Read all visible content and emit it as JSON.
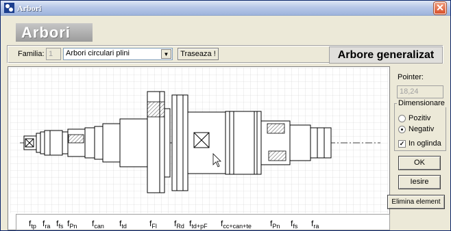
{
  "window": {
    "title": "Arbori",
    "close_glyph": "✕"
  },
  "logo": {
    "text": "Arbori"
  },
  "toolbar": {
    "familia_label": "Familia:",
    "familia_number": "1",
    "familia_value": "Arbori circulari plini",
    "traseaza_label": "Traseaza !",
    "heading": "Arbore generalizat"
  },
  "side_panel": {
    "pointer_label": "Pointer:",
    "pointer_value": "18,24",
    "dim_legend": "Dimensionare",
    "radio_pozitiv": "Pozitiv",
    "radio_negativ": "Negativ",
    "selected": "Negativ",
    "mirror_label": "In oglinda",
    "mirror_checked": true,
    "ok_label": "OK",
    "iesire_label": "Iesire",
    "elimina_label": "Elimina element"
  },
  "factors": [
    {
      "f": "f",
      "sub": "tp"
    },
    {
      "f": "f",
      "sub": "ra"
    },
    {
      "f": "f",
      "sub": "fs"
    },
    {
      "f": "f",
      "sub": "Pn"
    },
    {
      "f": "f",
      "sub": "can"
    },
    {
      "f": "f",
      "sub": "td"
    },
    {
      "f": "f",
      "sub": "Fl"
    },
    {
      "f": "f",
      "sub": "Rd"
    },
    {
      "f": "f",
      "sub": "td+pF"
    },
    {
      "f": "f",
      "sub": "cc+can+te"
    },
    {
      "f": "f",
      "sub": "Pn"
    },
    {
      "f": "f",
      "sub": "fs"
    },
    {
      "f": "f",
      "sub": "ra"
    }
  ],
  "colors": {
    "titlebar": "#9eb4dc",
    "grid": "#c0c0c0",
    "drawing": "#000000",
    "close": "#d8502a"
  }
}
